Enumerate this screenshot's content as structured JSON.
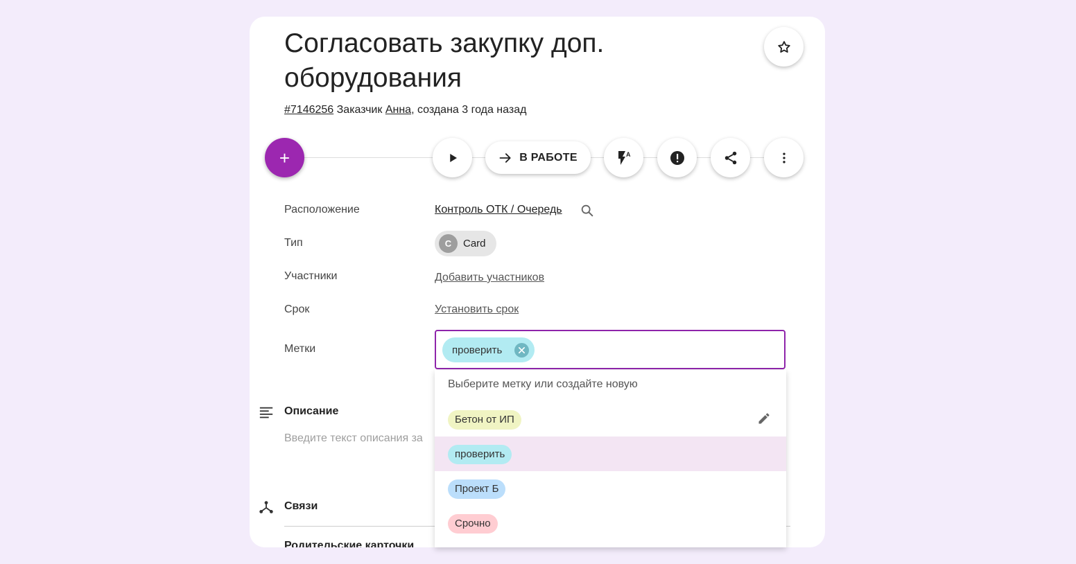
{
  "card": {
    "title": "Согласовать закупку доп. оборудования",
    "id_link": "#7146256",
    "customer_prefix": "Заказчик",
    "customer_name": "Анна",
    "created_text": ", создана 3 года назад"
  },
  "toolbar": {
    "add_label": "+",
    "status_label": "В РАБОТЕ"
  },
  "icons": {
    "star": "star-outline-icon",
    "play": "play-icon",
    "arrow": "arrow-right-icon",
    "auto_flash": "flash-auto-icon",
    "alert": "alert-circle-icon",
    "share": "share-icon",
    "more": "more-vertical-icon",
    "search": "search-icon",
    "edit": "pencil-icon",
    "description": "text-lines-icon",
    "relations": "hub-icon",
    "remove": "close-circle-icon"
  },
  "fields": {
    "location_label": "Расположение",
    "location_value": "Контроль ОТК / Очередь",
    "type_label": "Тип",
    "type_avatar": "C",
    "type_value": "Card",
    "members_label": "Участники",
    "members_link": "Добавить участников",
    "due_label": "Срок",
    "due_link": "Установить срок",
    "tags_label": "Метки",
    "selected_tag": "проверить"
  },
  "description": {
    "title": "Описание",
    "placeholder": "Введите текст описания за"
  },
  "relations": {
    "title": "Связи",
    "parent_cards": "Родительские карточки"
  },
  "dropdown": {
    "hint": "Выберите метку или создайте новую",
    "options": [
      {
        "label": "Бетон от ИП",
        "color": "#f0f4c3"
      },
      {
        "label": "проверить",
        "color": "#b2ebf2"
      },
      {
        "label": "Проект Б",
        "color": "#bbdefb"
      },
      {
        "label": "Срочно",
        "color": "#ffcdd2"
      }
    ]
  },
  "colors": {
    "accent": "#9c27b0",
    "background": "#f3ecfb",
    "focus_border": "#8e24aa"
  }
}
